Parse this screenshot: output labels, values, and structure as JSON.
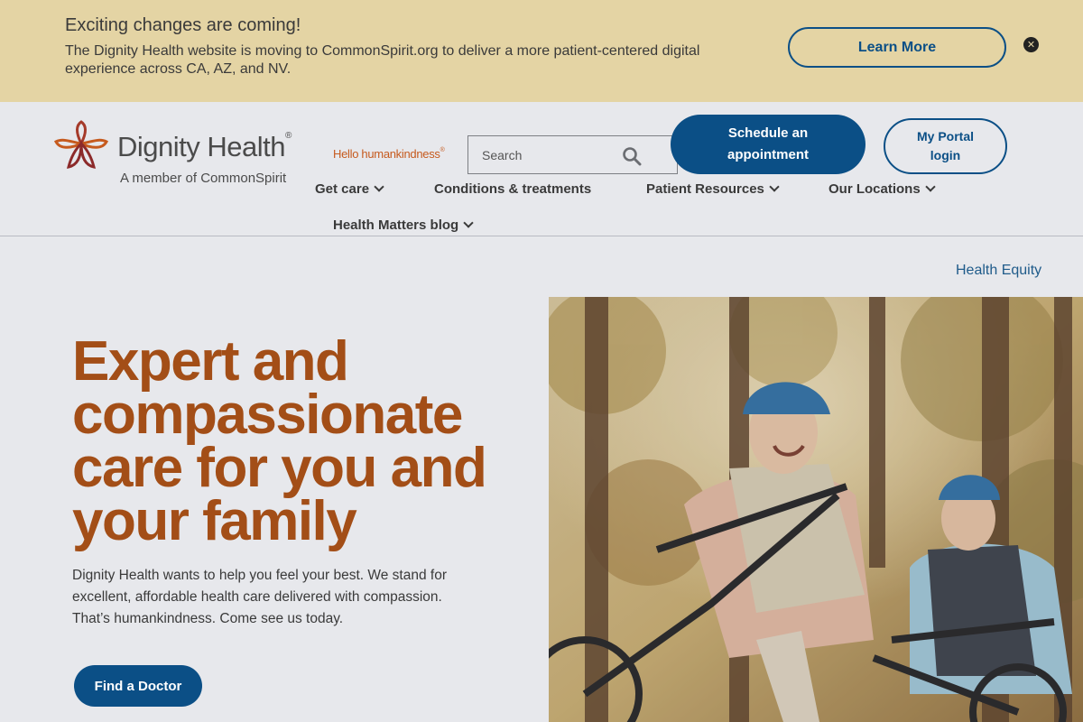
{
  "banner": {
    "title": "Exciting changes are coming!",
    "text": "The Dignity Health website is moving to CommonSpirit.org to deliver a more patient-centered digital experience across CA, AZ, and NV.",
    "learn_more_label": "Learn More",
    "close_glyph": "✕"
  },
  "header": {
    "logo_name": "Dignity Health",
    "logo_reg": "®",
    "logo_sub": "A member of CommonSpirit",
    "tagline": "Hello humankindness",
    "tagline_mark": "®",
    "search_placeholder": "Search",
    "schedule_label": "Schedule an appointment",
    "portal_label": "My Portal login"
  },
  "nav": {
    "get_care": "Get care",
    "conditions": "Conditions & treatments",
    "patient_resources": "Patient Resources",
    "locations": "Our Locations",
    "blog": "Health Matters blog"
  },
  "main": {
    "equity_link": "Health Equity",
    "hero_title": "Expert and compassionate care for you and your family",
    "hero_text": "Dignity Health wants to help you feel your best. We stand for excellent, affordable health care delivered with compassion. That’s humankindness. Come see us today.",
    "find_doctor_label": "Find a Doctor"
  },
  "colors": {
    "brand_blue": "#0b4f86",
    "brand_orange": "#a34e17",
    "banner_bg": "#e4d4a4",
    "page_bg": "#e7e8ec"
  },
  "icons": {
    "logo_mark": "dignity-health-logo-icon",
    "search": "search-icon",
    "close": "close-icon",
    "chevron": "chevron-down-icon"
  }
}
